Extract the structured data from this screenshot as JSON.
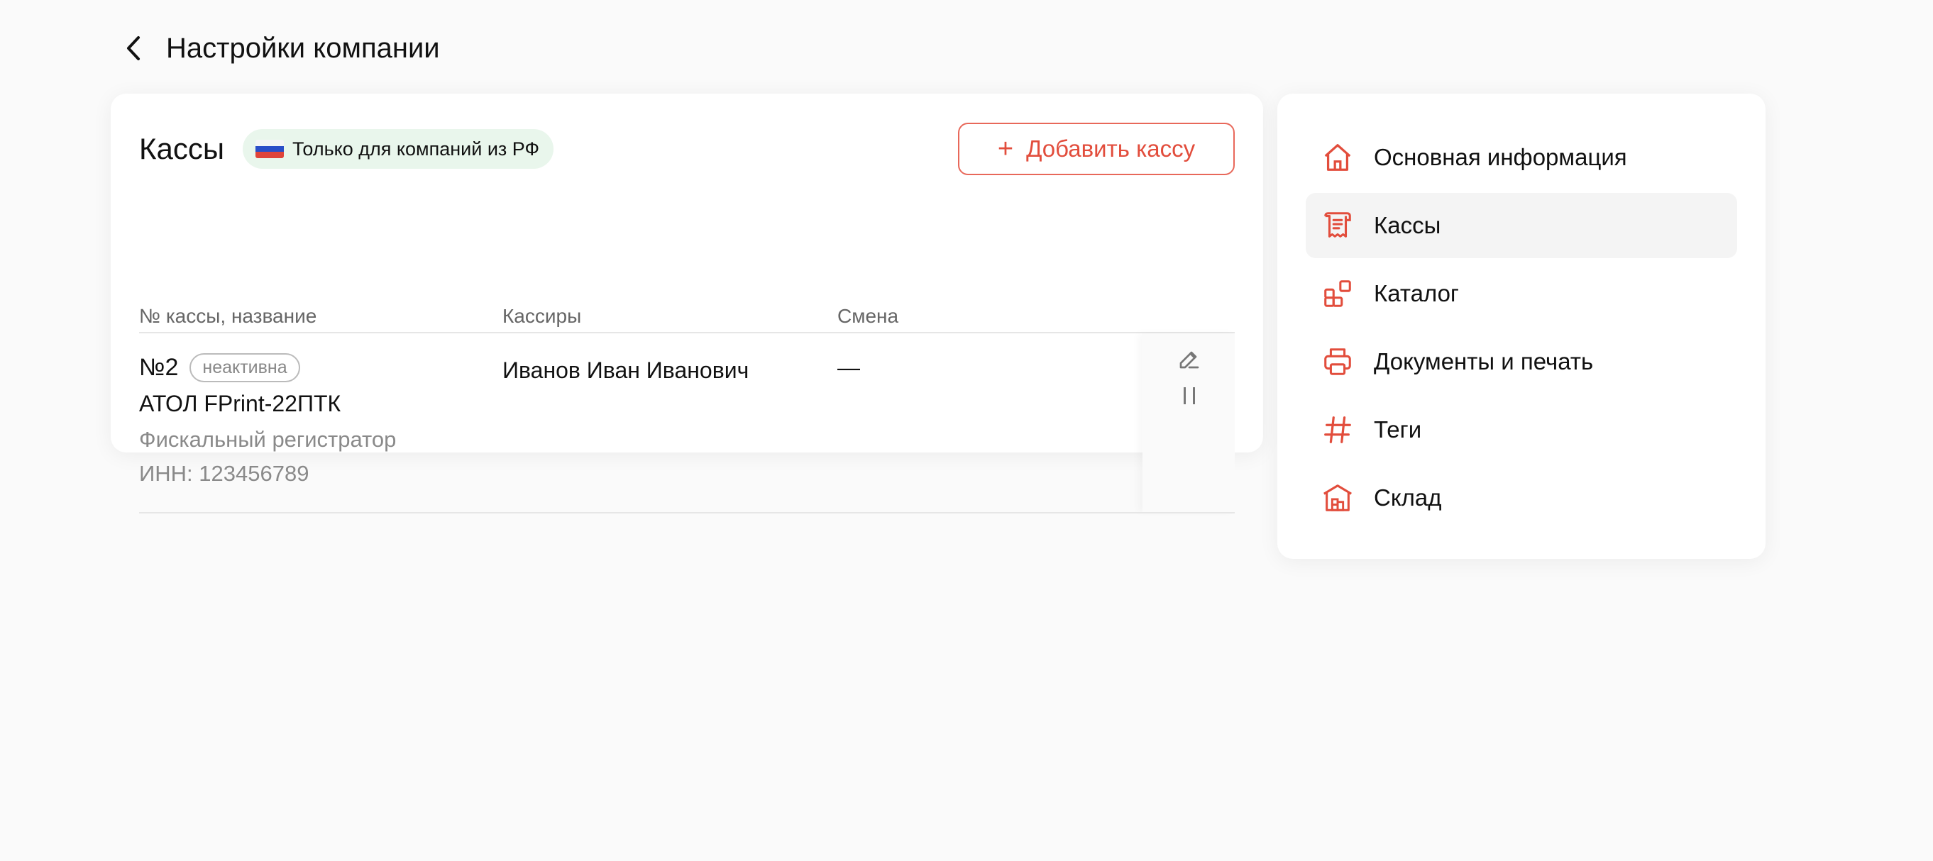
{
  "page": {
    "title": "Настройки компании"
  },
  "section": {
    "title": "Кассы",
    "region_badge": "Только для компаний из РФ",
    "add_button": "Добавить кассу"
  },
  "table": {
    "headers": [
      "№ кассы, название",
      "Кассиры",
      "Смена"
    ],
    "rows": [
      {
        "number": "№2",
        "status": "неактивна",
        "model": "АТОЛ FPrint-22ПТК",
        "type": "Фискальный регистратор",
        "inn": "ИНН: 123456789",
        "cashiers": "Иванов Иван Иванович",
        "shift": "—"
      }
    ]
  },
  "menu": {
    "items": [
      {
        "label": "Основная информация",
        "icon": "home-icon",
        "active": false
      },
      {
        "label": "Кассы",
        "icon": "receipt-icon",
        "active": true
      },
      {
        "label": "Каталог",
        "icon": "catalog-icon",
        "active": false
      },
      {
        "label": "Документы и печать",
        "icon": "printer-icon",
        "active": false
      },
      {
        "label": "Теги",
        "icon": "hash-icon",
        "active": false
      },
      {
        "label": "Склад",
        "icon": "warehouse-icon",
        "active": false
      }
    ]
  },
  "colors": {
    "accent": "#e24d3c",
    "badge_bg": "#e9f6ec",
    "background": "#fafafa",
    "active_item": "#f4f4f4"
  }
}
